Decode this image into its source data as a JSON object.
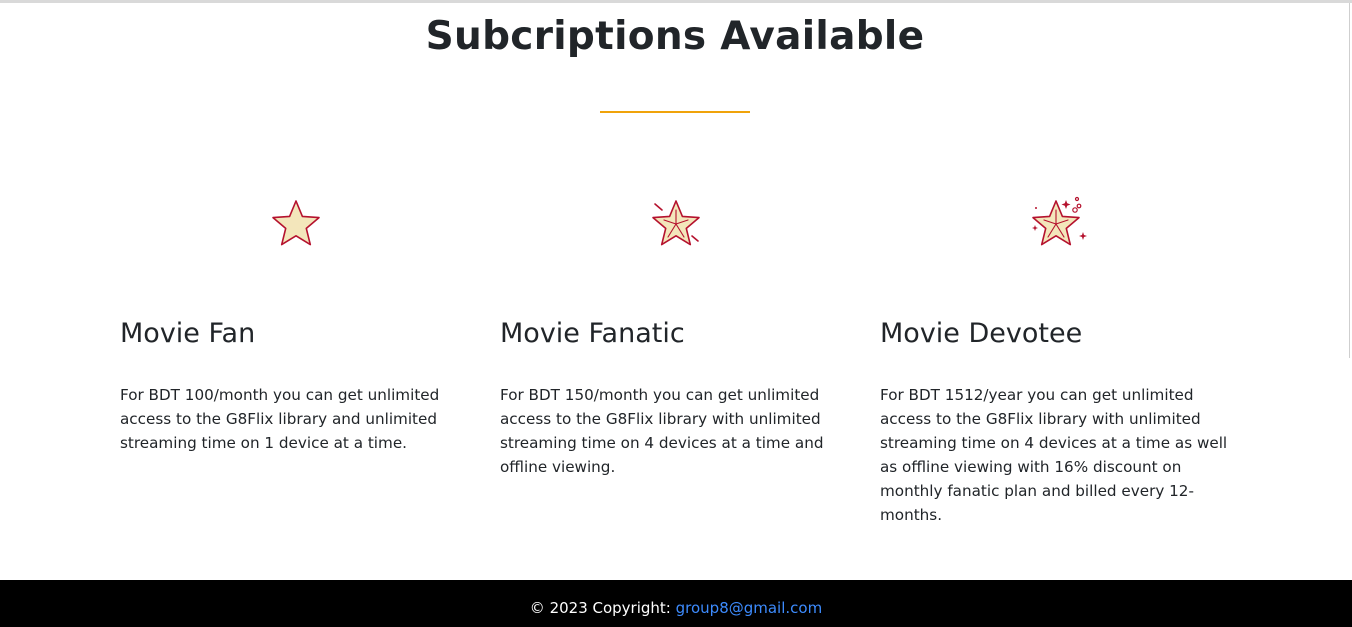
{
  "section": {
    "title": "Subcriptions Available"
  },
  "colors": {
    "accent_underline": "#f0a30a",
    "star_fill": "#f3e6bb",
    "star_stroke": "#b5122e",
    "footer_bg": "#000000",
    "link": "#3d8bfd"
  },
  "plans": [
    {
      "icon": "star-icon",
      "name": "Movie Fan",
      "description": "For BDT 100/month you can get unlimited access to the G8Flix library and unlimited streaming time on 1 device at a time."
    },
    {
      "icon": "star-sparkle-icon",
      "name": "Movie Fanatic",
      "description": "For BDT 150/month you can get unlimited access to the G8Flix library with unlimited streaming time on 4 devices at a time and offline viewing."
    },
    {
      "icon": "star-sparkles-icon",
      "name": "Movie Devotee",
      "description": "For BDT 1512/year you can get unlimited access to the G8Flix library with unlimited streaming time on 4 devices at a time as well as offline viewing with 16% discount on monthly fanatic plan and billed every 12-months."
    }
  ],
  "footer": {
    "copyright": "© 2023 Copyright: ",
    "email": "group8@gmail.com"
  }
}
